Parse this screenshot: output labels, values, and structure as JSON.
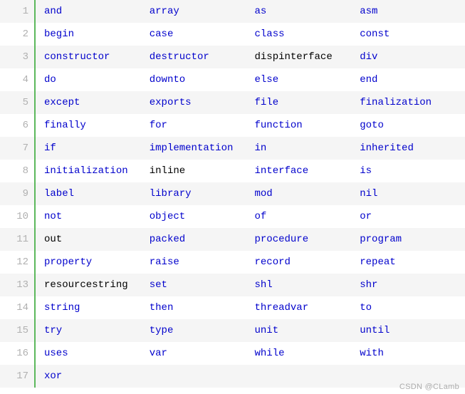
{
  "rows": [
    {
      "line": "1",
      "cells": [
        {
          "text": "and",
          "type": "kw"
        },
        {
          "text": "array",
          "type": "kw"
        },
        {
          "text": "as",
          "type": "kw"
        },
        {
          "text": "asm",
          "type": "kw"
        }
      ]
    },
    {
      "line": "2",
      "cells": [
        {
          "text": "begin",
          "type": "kw"
        },
        {
          "text": "case",
          "type": "kw"
        },
        {
          "text": "class",
          "type": "kw"
        },
        {
          "text": "const",
          "type": "kw"
        }
      ]
    },
    {
      "line": "3",
      "cells": [
        {
          "text": "constructor",
          "type": "kw"
        },
        {
          "text": "destructor",
          "type": "kw"
        },
        {
          "text": "dispinterface",
          "type": "plain"
        },
        {
          "text": "div",
          "type": "kw"
        }
      ]
    },
    {
      "line": "4",
      "cells": [
        {
          "text": "do",
          "type": "kw"
        },
        {
          "text": "downto",
          "type": "kw"
        },
        {
          "text": "else",
          "type": "kw"
        },
        {
          "text": "end",
          "type": "kw"
        }
      ]
    },
    {
      "line": "5",
      "cells": [
        {
          "text": "except",
          "type": "kw"
        },
        {
          "text": "exports",
          "type": "kw"
        },
        {
          "text": "file",
          "type": "kw"
        },
        {
          "text": "finalization",
          "type": "kw"
        }
      ]
    },
    {
      "line": "6",
      "cells": [
        {
          "text": "finally",
          "type": "kw"
        },
        {
          "text": "for",
          "type": "kw"
        },
        {
          "text": "function",
          "type": "kw"
        },
        {
          "text": "goto",
          "type": "kw"
        }
      ]
    },
    {
      "line": "7",
      "cells": [
        {
          "text": "if",
          "type": "kw"
        },
        {
          "text": "implementation",
          "type": "kw"
        },
        {
          "text": "in",
          "type": "kw"
        },
        {
          "text": "inherited",
          "type": "kw"
        }
      ]
    },
    {
      "line": "8",
      "cells": [
        {
          "text": "initialization",
          "type": "kw"
        },
        {
          "text": "inline",
          "type": "plain"
        },
        {
          "text": "interface",
          "type": "kw"
        },
        {
          "text": "is",
          "type": "kw"
        }
      ]
    },
    {
      "line": "9",
      "cells": [
        {
          "text": "label",
          "type": "kw"
        },
        {
          "text": "library",
          "type": "kw"
        },
        {
          "text": "mod",
          "type": "kw"
        },
        {
          "text": "nil",
          "type": "kw"
        }
      ]
    },
    {
      "line": "10",
      "cells": [
        {
          "text": "not",
          "type": "kw"
        },
        {
          "text": "object",
          "type": "kw"
        },
        {
          "text": "of",
          "type": "kw"
        },
        {
          "text": "or",
          "type": "kw"
        }
      ]
    },
    {
      "line": "11",
      "cells": [
        {
          "text": "out",
          "type": "plain"
        },
        {
          "text": "packed",
          "type": "kw"
        },
        {
          "text": "procedure",
          "type": "kw"
        },
        {
          "text": "program",
          "type": "kw"
        }
      ]
    },
    {
      "line": "12",
      "cells": [
        {
          "text": "property",
          "type": "kw"
        },
        {
          "text": "raise",
          "type": "kw"
        },
        {
          "text": "record",
          "type": "kw"
        },
        {
          "text": "repeat",
          "type": "kw"
        }
      ]
    },
    {
      "line": "13",
      "cells": [
        {
          "text": "resourcestring",
          "type": "plain"
        },
        {
          "text": "set",
          "type": "kw"
        },
        {
          "text": "shl",
          "type": "kw"
        },
        {
          "text": "shr",
          "type": "kw"
        }
      ]
    },
    {
      "line": "14",
      "cells": [
        {
          "text": "string",
          "type": "kw"
        },
        {
          "text": "then",
          "type": "kw"
        },
        {
          "text": "threadvar",
          "type": "kw"
        },
        {
          "text": "to",
          "type": "kw"
        }
      ]
    },
    {
      "line": "15",
      "cells": [
        {
          "text": "try",
          "type": "kw"
        },
        {
          "text": "type",
          "type": "kw"
        },
        {
          "text": "unit",
          "type": "kw"
        },
        {
          "text": "until",
          "type": "kw"
        }
      ]
    },
    {
      "line": "16",
      "cells": [
        {
          "text": "uses",
          "type": "kw"
        },
        {
          "text": "var",
          "type": "kw"
        },
        {
          "text": "while",
          "type": "kw"
        },
        {
          "text": "with",
          "type": "kw"
        }
      ]
    },
    {
      "line": "17",
      "cells": [
        {
          "text": "xor",
          "type": "kw"
        },
        {
          "text": "",
          "type": "plain"
        },
        {
          "text": "",
          "type": "plain"
        },
        {
          "text": "",
          "type": "plain"
        }
      ]
    }
  ],
  "watermark": "CSDN @CLamb"
}
